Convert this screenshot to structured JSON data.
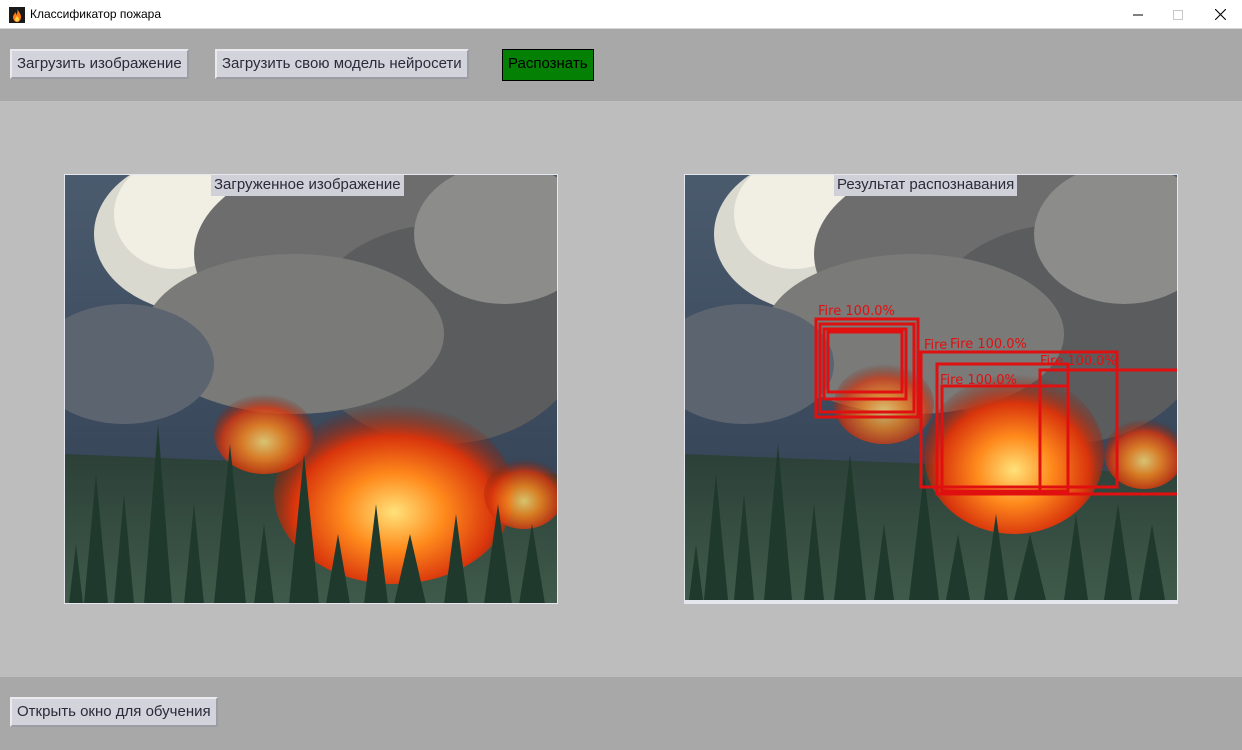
{
  "window": {
    "title": "Классификатор пожара",
    "controls": [
      "minimize-icon",
      "maximize-icon",
      "close-icon"
    ]
  },
  "toolbar": {
    "load_image_label": "Загрузить изображение",
    "load_model_label": "Загрузить свою модель нейросети",
    "recognize_label": "Распознать",
    "recognize_color": "#048004"
  },
  "panels": {
    "input_label": "Загруженное изображение",
    "result_label": "Результат распознавания"
  },
  "detections": [
    {
      "label": "Fire",
      "confidence": "100.0%"
    },
    {
      "label": "Fire",
      "confidence": "100.0%"
    },
    {
      "label": "Fire",
      "confidence": "100.0%"
    },
    {
      "label": "Fire",
      "confidence": "100.0%"
    },
    {
      "label": "Fire",
      "confidence": "100.0%"
    }
  ],
  "detection_color": "#e01010",
  "footer": {
    "open_training_label": "Открыть окно для обучения"
  }
}
